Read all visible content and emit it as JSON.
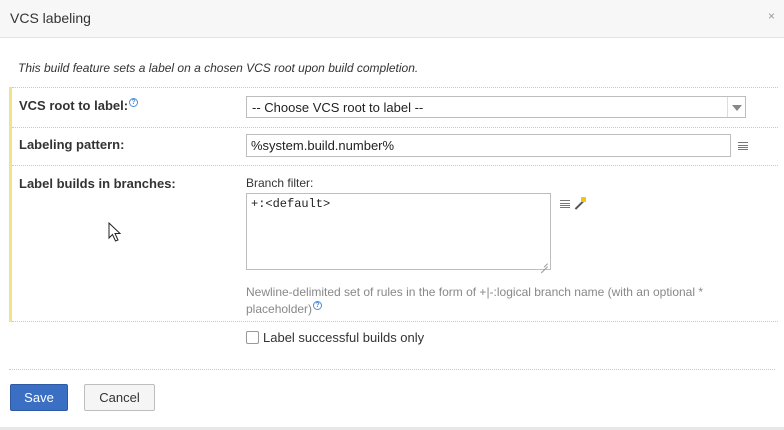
{
  "dialog": {
    "title": "VCS labeling",
    "close_glyph": "×",
    "description": "This build feature sets a label on a chosen VCS root upon build completion."
  },
  "form": {
    "vcs_root": {
      "label": "VCS root to label:",
      "help_glyph": "?",
      "selected": "-- Choose VCS root to label --"
    },
    "labeling_pattern": {
      "label": "Labeling pattern:",
      "value": "%system.build.number%"
    },
    "branches": {
      "label": "Label builds in branches:",
      "filter_label": "Branch filter:",
      "filter_value": "+:<default>",
      "hint": "Newline-delimited set of rules in the form of +|-:logical branch name (with an optional * placeholder)",
      "help_glyph": "?"
    },
    "successful_only": {
      "label": "Label successful builds only",
      "checked": false
    }
  },
  "buttons": {
    "save": "Save",
    "cancel": "Cancel"
  },
  "colors": {
    "accent": "#3a6fc3",
    "form_marker": "#f2e38a",
    "help": "#4a8fd6"
  }
}
